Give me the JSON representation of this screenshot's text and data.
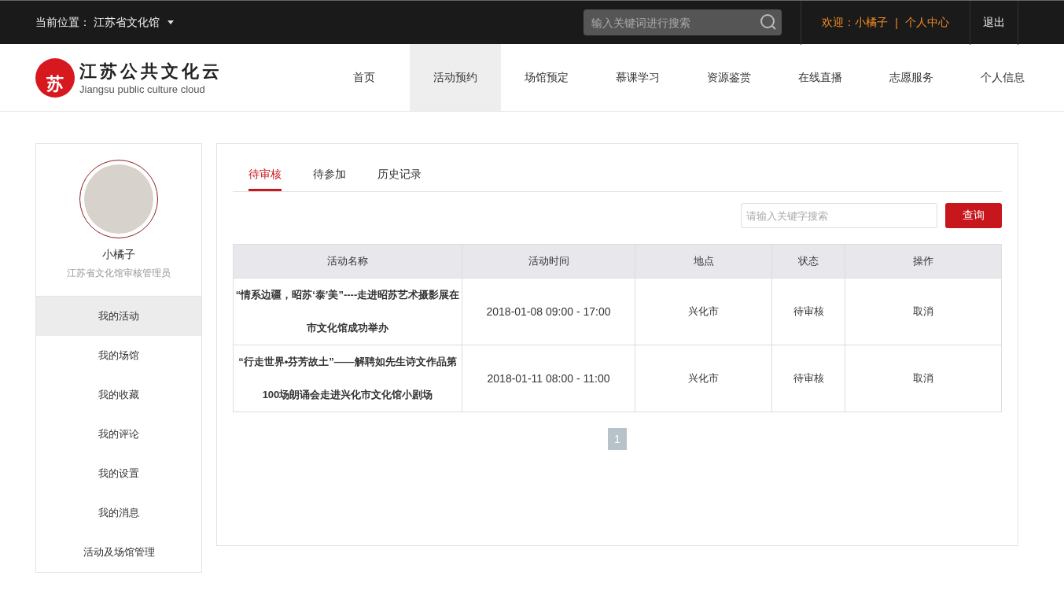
{
  "top_bar": {
    "location_label": "当前位置：",
    "location": "江苏省文化馆",
    "search": {
      "placeholder": "输入关键词进行搜索"
    },
    "welcome": "欢迎：小橘子",
    "separator": "|",
    "user_center": "个人中心",
    "logout": "退出"
  },
  "logo": {
    "mark": "苏",
    "title": "江苏公共文化云",
    "subtitle": "Jiangsu public culture cloud"
  },
  "nav": [
    {
      "label": "首页",
      "selected": false
    },
    {
      "label": "活动预约",
      "selected": true
    },
    {
      "label": "场馆预定",
      "selected": false
    },
    {
      "label": "慕课学习",
      "selected": false
    },
    {
      "label": "资源鉴赏",
      "selected": false
    },
    {
      "label": "在线直播",
      "selected": false
    },
    {
      "label": "志愿服务",
      "selected": false
    },
    {
      "label": "个人信息",
      "selected": false
    }
  ],
  "profile": {
    "name": "小橘子",
    "role": "江苏省文化馆审核管理员"
  },
  "sidebar": {
    "items": [
      {
        "label": "我的活动",
        "selected": true
      },
      {
        "label": "我的场馆",
        "selected": false
      },
      {
        "label": "我的收藏",
        "selected": false
      },
      {
        "label": "我的评论",
        "selected": false
      },
      {
        "label": "我的设置",
        "selected": false
      },
      {
        "label": "我的消息",
        "selected": false
      },
      {
        "label": "活动及场馆管理",
        "selected": false
      }
    ]
  },
  "tabs": [
    {
      "label": "待审核",
      "selected": true
    },
    {
      "label": "待参加",
      "selected": false
    },
    {
      "label": "历史记录",
      "selected": false
    }
  ],
  "search": {
    "placeholder": "请输入关键字搜索",
    "button": "查询"
  },
  "table": {
    "columns": [
      "活动名称",
      "活动时间",
      "地点",
      "状态",
      "操作"
    ],
    "rows": [
      {
        "name": "“情系边疆，昭苏‘泰’美”----走进昭苏艺术摄影展在市文化馆成功举办",
        "time": "2018-01-08 09:00 - 17:00",
        "place": "兴化市",
        "status": "待审核",
        "action": "取消"
      },
      {
        "name": "“行走世界•芬芳故土”——解聘如先生诗文作品第100场朗诵会走进兴化市文化馆小剧场",
        "time": "2018-01-11 08:00 - 11:00",
        "place": "兴化市",
        "status": "待审核",
        "action": "取消"
      }
    ]
  },
  "pagination": [
    {
      "label": "1",
      "selected": true
    }
  ]
}
